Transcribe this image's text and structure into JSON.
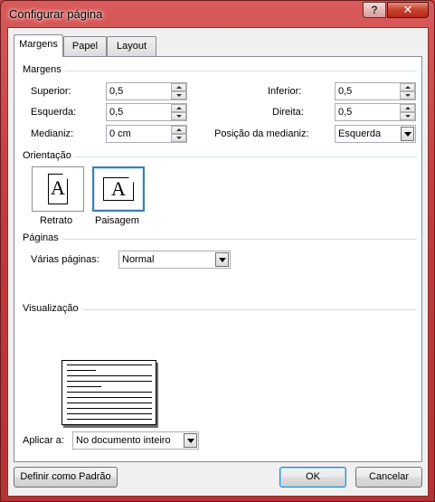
{
  "window": {
    "title": "Configurar página",
    "help": "?",
    "close": "✕"
  },
  "tabs": [
    {
      "label": "Margens",
      "active": true
    },
    {
      "label": "Papel",
      "active": false
    },
    {
      "label": "Layout",
      "active": false
    }
  ],
  "margins": {
    "section": "Margens",
    "superior": {
      "label": "Superior:",
      "value": "0,5"
    },
    "inferior": {
      "label": "Inferior:",
      "value": "0,5"
    },
    "esquerda": {
      "label": "Esquerda:",
      "value": "0,5"
    },
    "direita": {
      "label": "Direita:",
      "value": "0,5"
    },
    "medianiz": {
      "label": "Medianiz:",
      "value": "0 cm"
    },
    "posicao": {
      "label": "Posição da medianiz:",
      "value": "Esquerda"
    }
  },
  "orientation": {
    "section": "Orientação",
    "retrato": {
      "label": "Retrato",
      "glyph": "A",
      "selected": false
    },
    "paisagem": {
      "label": "Paisagem",
      "glyph": "A",
      "selected": true
    }
  },
  "pages": {
    "section": "Páginas",
    "label": "Várias páginas:",
    "value": "Normal"
  },
  "preview": {
    "section": "Visualização"
  },
  "apply": {
    "label": "Aplicar a:",
    "value": "No documento inteiro"
  },
  "buttons": {
    "default": "Definir como Padrão",
    "ok": "OK",
    "cancel": "Cancelar"
  },
  "colors": {
    "titlebar": "#c13c3c",
    "selection": "#3c7fb1"
  }
}
